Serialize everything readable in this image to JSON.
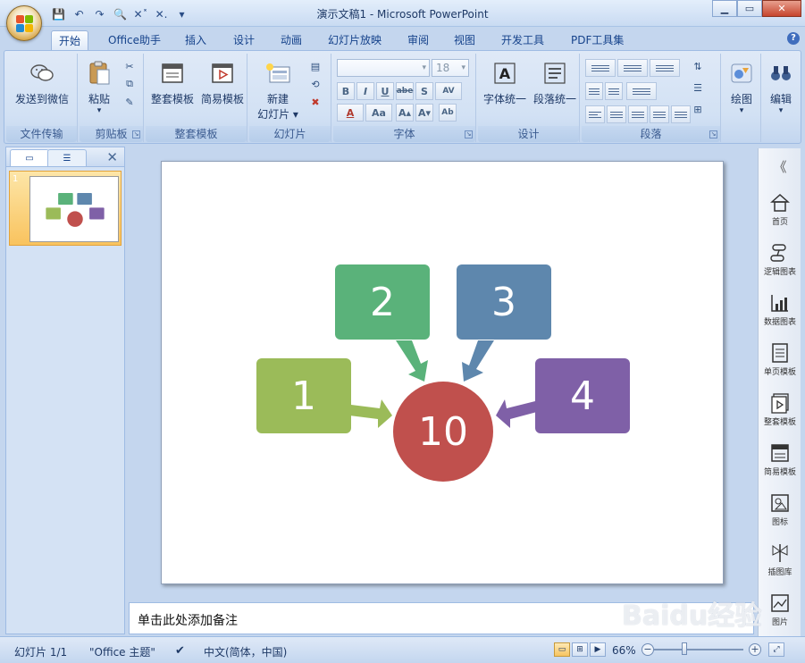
{
  "window": {
    "title": "演示文稿1 - Microsoft PowerPoint",
    "controls": [
      "▁",
      "▭",
      "✕"
    ]
  },
  "qat": [
    "💾",
    "↶",
    "↷",
    "🔍",
    "✕˟",
    "✕.",
    "▾"
  ],
  "tabs": [
    "开始",
    "Office助手",
    "插入",
    "设计",
    "动画",
    "幻灯片放映",
    "审阅",
    "视图",
    "开发工具",
    "PDF工具集"
  ],
  "active_tab": "开始",
  "help": "?",
  "ribbon": {
    "wechat": {
      "button": "发送到微信",
      "group": "文件传输"
    },
    "clipboard": {
      "paste": "粘贴",
      "paste_arrow": "▾",
      "group": "剪贴板"
    },
    "templates": {
      "full": "整套模板",
      "simple": "简易模板",
      "group": "整套模板"
    },
    "slides": {
      "new_line1": "新建",
      "new_line2": "幻灯片 ▾",
      "group": "幻灯片"
    },
    "font": {
      "name": "",
      "size": "18",
      "group": "字体",
      "buttons": [
        "B",
        "I",
        "U",
        "abe",
        "S",
        "AV",
        "A",
        "Aa",
        "A▴",
        "A▾",
        "Ab"
      ]
    },
    "design": {
      "font_unify": "字体统一",
      "para_unify": "段落统一",
      "group": "设计"
    },
    "paragraph": {
      "group": "段落"
    },
    "drawing": {
      "button": "绘图",
      "arrow": "▾"
    },
    "editing": {
      "button": "编辑",
      "arrow": "▾"
    }
  },
  "left_pane": {
    "close": "✕",
    "slide_number": "1"
  },
  "slide": {
    "boxes": [
      {
        "label": "1",
        "color": "#9bbb59"
      },
      {
        "label": "2",
        "color": "#5ab27a"
      },
      {
        "label": "3",
        "color": "#5e87ad"
      },
      {
        "label": "4",
        "color": "#7f60a7"
      }
    ],
    "center": {
      "label": "10",
      "color": "#c0504d"
    }
  },
  "notes": {
    "placeholder": "单击此处添加备注"
  },
  "right_panel": {
    "collapse": "《",
    "items": [
      "首页",
      "逻辑图表",
      "数据图表",
      "单页模板",
      "整套模板",
      "简易模板",
      "图标",
      "插图库",
      "图片"
    ]
  },
  "watermark": "Baidu经验",
  "status": {
    "slide_info": "幻灯片 1/1",
    "theme": "\"Office 主题\"",
    "language": "中文(简体，中国)",
    "zoom": "66%",
    "zoom_minus": "−",
    "zoom_plus": "+"
  },
  "colors": {
    "ribbon_bg": "#d2e1f4",
    "accent": "#15428b"
  }
}
